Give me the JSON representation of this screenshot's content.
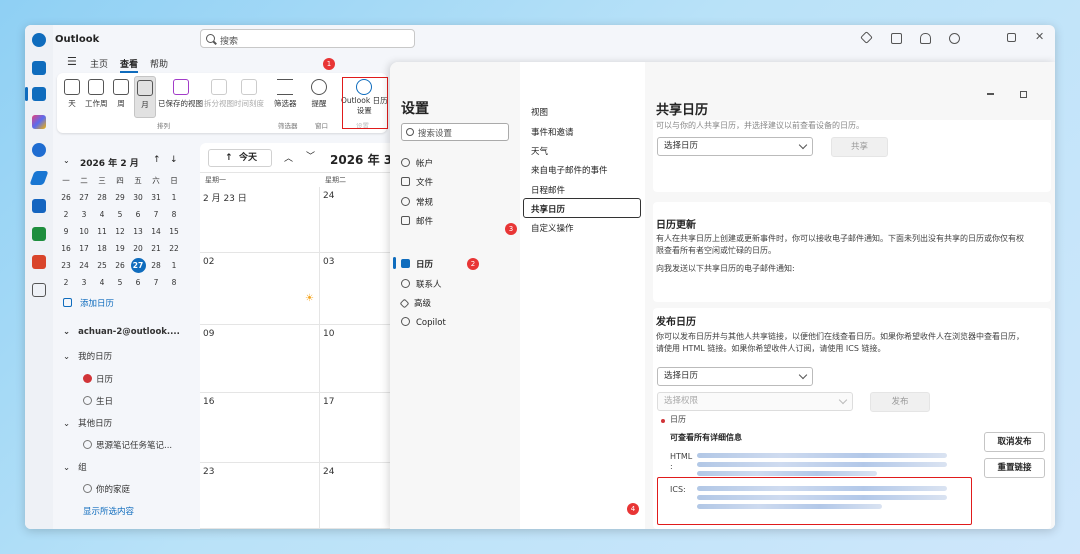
{
  "app": {
    "title": "Outlook",
    "search_placeholder": "搜索"
  },
  "menu": {
    "items": [
      "主页",
      "查看",
      "帮助"
    ],
    "selected": "查看"
  },
  "ribbon": {
    "buttons": [
      {
        "label": "天",
        "disabled": false
      },
      {
        "label": "工作周",
        "disabled": false
      },
      {
        "label": "周",
        "disabled": false
      },
      {
        "label": "月",
        "disabled": false
      },
      {
        "label": "已保存的视图",
        "disabled": false
      },
      {
        "label": "拆分视图",
        "disabled": true
      },
      {
        "label": "时间刻度",
        "disabled": true
      },
      {
        "label": "筛选器",
        "disabled": false
      },
      {
        "label": "提醒",
        "disabled": false
      }
    ],
    "outlook_settings_label1": "Outlook 日历",
    "outlook_settings_label2": "设置",
    "groups": [
      "排列",
      "筛选器",
      "窗口",
      "设置"
    ]
  },
  "annotations": [
    "1",
    "2",
    "3",
    "4"
  ],
  "minical": {
    "title": "2026 年 2 月",
    "weekdays": [
      "一",
      "二",
      "三",
      "四",
      "五",
      "六",
      "日"
    ],
    "weeks": [
      [
        "26",
        "27",
        "28",
        "29",
        "30",
        "31",
        "1"
      ],
      [
        "2",
        "3",
        "4",
        "5",
        "6",
        "7",
        "8"
      ],
      [
        "9",
        "10",
        "11",
        "12",
        "13",
        "14",
        "15"
      ],
      [
        "16",
        "17",
        "18",
        "19",
        "20",
        "21",
        "22"
      ],
      [
        "23",
        "24",
        "25",
        "26",
        "27",
        "28",
        "1"
      ],
      [
        "2",
        "3",
        "4",
        "5",
        "6",
        "7",
        "8"
      ]
    ],
    "today": "27"
  },
  "folders": {
    "add_calendar": "添加日历",
    "account": "achuan-2@outlook....",
    "my_calendars": "我的日历",
    "calendar": "日历",
    "birthday": "生日",
    "other_calendars": "其他日历",
    "other_item": "思源笔记任务笔记...",
    "group": "组",
    "family": "你的家庭",
    "show_selected": "显示所选内容"
  },
  "calendar": {
    "today_button": "今天",
    "title": "2026 年 3 月",
    "col1": "星期一",
    "col2": "星期二",
    "rows": [
      [
        "2 月 23 日",
        "24"
      ],
      [
        "02",
        "03"
      ],
      [
        "09",
        "10"
      ],
      [
        "16",
        "17"
      ],
      [
        "23",
        "24"
      ]
    ]
  },
  "settings": {
    "title": "设置",
    "search_placeholder": "搜索设置",
    "nav": [
      "帐户",
      "文件",
      "常规",
      "邮件",
      "日历",
      "联系人",
      "高级",
      "Copilot"
    ],
    "nav_selected": "日历",
    "subnav": [
      "视图",
      "事件和邀请",
      "天气",
      "来自电子邮件的事件",
      "日程邮件",
      "共享日历",
      "自定义操作"
    ],
    "subnav_selected": "共享日历",
    "page_title": "共享日历",
    "truncated_text": "可以与你的人共享日历，并选择建议以前查看设备的日历。",
    "select_calendar": "选择日历",
    "share_button": "共享",
    "update_heading": "日历更新",
    "update_text1": "有人在共享日历上创建或更新事件时，你可以接收电子邮件通知。下面未列出没有共享的日历或你仅有权",
    "update_text2": "限查看所有者空闲或忙碌的日历。",
    "update_text3": "向我发送以下共享日历的电子邮件通知:",
    "publish_heading": "发布日历",
    "publish_text1": "你可以发布日历并与其他人共享链接，以便他们在线查看日历。如果你希望收件人在浏览器中查看日历，",
    "publish_text2": "请使用 HTML 链接。如果你希望收件人订阅，请使用 ICS 链接。",
    "select_permission": "选择权限",
    "publish_button": "发布",
    "published_calendar": "日历",
    "detail_label": "可查看所有详细信息",
    "html_label": "HTML",
    "html_colon": ":",
    "ics_label": "ICS:",
    "unpublish_button": "取消发布",
    "reset_button": "重置链接"
  }
}
